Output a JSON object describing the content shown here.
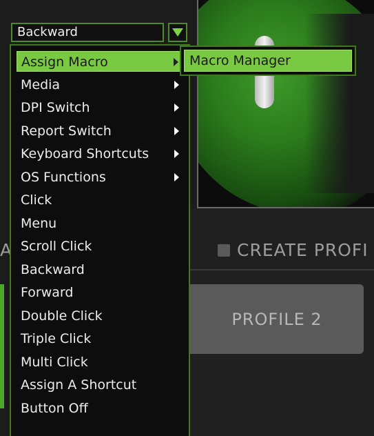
{
  "selected_action": "Backward",
  "menu": {
    "items": [
      {
        "label": "Assign Macro",
        "submenu": true,
        "active": true
      },
      {
        "label": "Media",
        "submenu": true
      },
      {
        "label": "DPI Switch",
        "submenu": true
      },
      {
        "label": "Report Switch",
        "submenu": true
      },
      {
        "label": "Keyboard Shortcuts",
        "submenu": true
      },
      {
        "label": "OS Functions",
        "submenu": true
      },
      {
        "label": "Click"
      },
      {
        "label": "Menu"
      },
      {
        "label": "Scroll Click"
      },
      {
        "label": "Backward"
      },
      {
        "label": "Forward"
      },
      {
        "label": "Double Click"
      },
      {
        "label": "Triple Click"
      },
      {
        "label": "Multi Click"
      },
      {
        "label": "Assign A Shortcut"
      },
      {
        "label": "Button Off"
      }
    ]
  },
  "submenu": {
    "items": [
      {
        "label": "Macro Manager"
      }
    ]
  },
  "background": {
    "create_profile_label": "CREATE PROFI",
    "profile_2_label": "PROFILE 2",
    "left_edge_char": "A"
  },
  "colors": {
    "accent_green": "#7ac943",
    "border_green": "#3f7a1f",
    "menu_bg": "#0d0d0d"
  }
}
